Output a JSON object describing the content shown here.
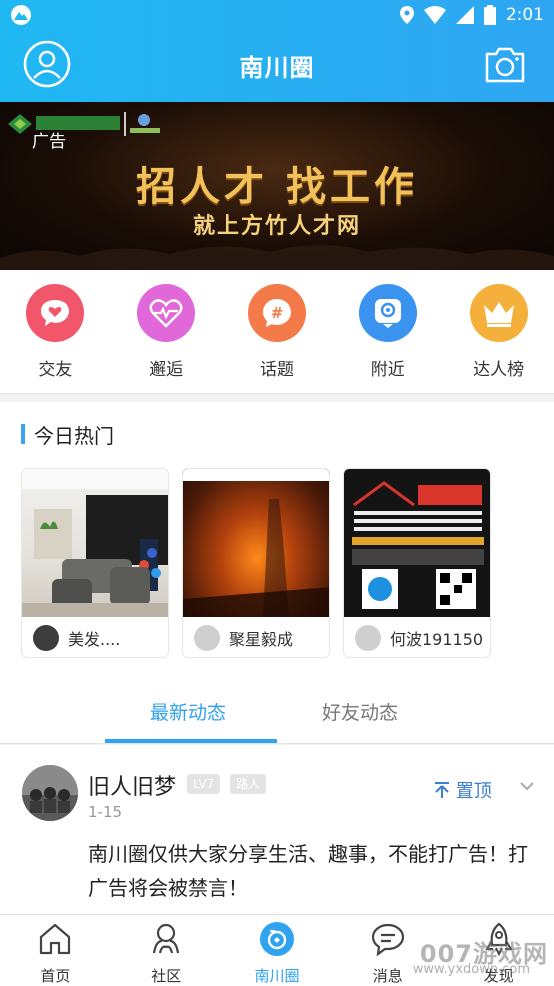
{
  "status_bar": {
    "time": "2:01"
  },
  "header": {
    "title": "南川圈"
  },
  "banner": {
    "ad_label": "广告",
    "headline": "招人才    找工作",
    "subline": "就上方竹人才网"
  },
  "quick_nav": [
    {
      "label": "交友",
      "icon": "heart-chat-icon",
      "color": "#f2566a"
    },
    {
      "label": "邂逅",
      "icon": "heartbeat-icon",
      "color": "#e168d8"
    },
    {
      "label": "话题",
      "icon": "hashtag-icon",
      "color": "#f47a4a"
    },
    {
      "label": "附近",
      "icon": "location-pin-icon",
      "color": "#3a93ee"
    },
    {
      "label": "达人榜",
      "icon": "crown-icon",
      "color": "#f4b03a"
    }
  ],
  "hot_today": {
    "title": "今日热门",
    "cards": [
      {
        "name": "美发...."
      },
      {
        "name": "聚星毅成"
      },
      {
        "name": "何波191150"
      }
    ]
  },
  "tabs": {
    "active": "最新动态",
    "inactive": "好友动态"
  },
  "post": {
    "username": "旧人旧梦",
    "level": "LV7",
    "rank": "路人",
    "date": "1-15",
    "pin_label": "置顶",
    "text": "南川圈仅供大家分享生活、趣事，不能打广告！打广告将会被禁言！"
  },
  "bottom_nav": [
    {
      "label": "首页",
      "icon": "home-icon"
    },
    {
      "label": "社区",
      "icon": "community-icon"
    },
    {
      "label": "南川圈",
      "icon": "circle-camera-icon",
      "active": true
    },
    {
      "label": "消息",
      "icon": "message-icon"
    },
    {
      "label": "发现",
      "icon": "rocket-icon"
    }
  ],
  "watermark": {
    "main": "007游戏网",
    "sub": "www.yxdown.com"
  },
  "colors": {
    "accent": "#2fa3ef",
    "header": "#1fb8f3"
  }
}
